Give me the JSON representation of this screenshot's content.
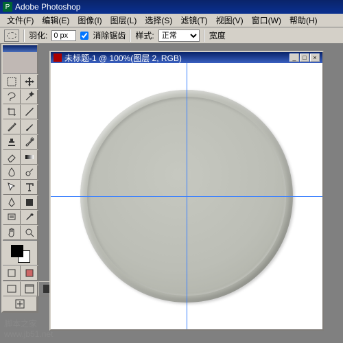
{
  "app": {
    "title": "Adobe Photoshop"
  },
  "menu": {
    "file": "文件(F)",
    "edit": "编辑(E)",
    "image": "图像(I)",
    "layer": "图层(L)",
    "select": "选择(S)",
    "filter": "滤镜(T)",
    "view": "视图(V)",
    "window": "窗口(W)",
    "help": "帮助(H)"
  },
  "options": {
    "feather_label": "羽化:",
    "feather_value": "0 px",
    "antialias_label": "消除锯齿",
    "antialias_checked": true,
    "style_label": "样式:",
    "style_value": "正常",
    "width_label": "宽度"
  },
  "document": {
    "title": "未标题-1 @ 100%(图层 2, RGB)"
  },
  "window_buttons": {
    "min": "_",
    "max": "□",
    "close": "×"
  },
  "toolbox": {
    "tools": [
      "rect-marquee-tool",
      "move-tool",
      "lasso-tool",
      "magic-wand-tool",
      "crop-tool",
      "slice-tool",
      "healing-tool",
      "brush-tool",
      "stamp-tool",
      "history-brush-tool",
      "eraser-tool",
      "gradient-tool",
      "blur-tool",
      "dodge-tool",
      "path-select-tool",
      "type-tool",
      "pen-tool",
      "shape-tool",
      "notes-tool",
      "eyedropper-tool",
      "hand-tool",
      "zoom-tool"
    ],
    "modes": [
      "standard-mode",
      "quickmask-mode"
    ],
    "screens": [
      "screen-standard",
      "screen-fullmenu",
      "screen-full"
    ],
    "jump": "jump-to-imageready"
  },
  "watermark": {
    "line1": "脚本之家",
    "line2": "www.jb51.net"
  },
  "colors": {
    "guide": "#3a80ff",
    "titlebar": "#0a246a",
    "panel": "#d4d0c8"
  }
}
